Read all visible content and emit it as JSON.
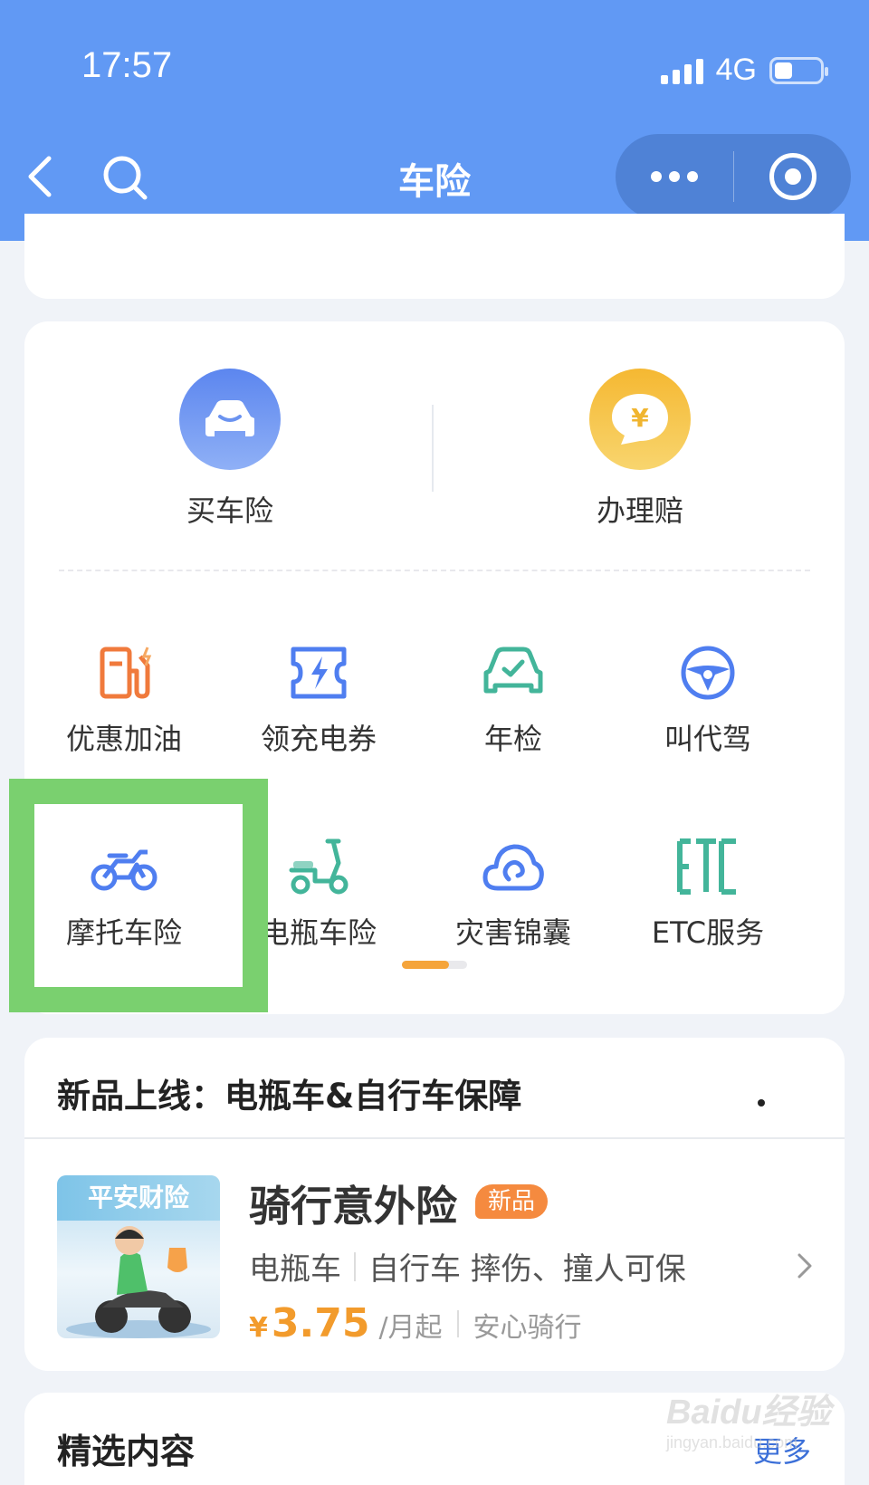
{
  "status_bar": {
    "time": "17:57",
    "network": "4G"
  },
  "nav": {
    "title": "车险",
    "icons": [
      "back-icon",
      "search-icon",
      "more-icon",
      "close-miniprogram-icon"
    ]
  },
  "services": {
    "primary": [
      {
        "label": "买车险",
        "icon": "car-icon",
        "color": "#6b93f0"
      },
      {
        "label": "办理赔",
        "icon": "yuan-chat-icon",
        "color": "#f6c13a"
      }
    ],
    "grid": [
      {
        "label": "优惠加油",
        "icon": "fuel-pump-icon",
        "color": "#f07a3c"
      },
      {
        "label": "领充电券",
        "icon": "charging-coupon-icon",
        "color": "#4f7ef0"
      },
      {
        "label": "年检",
        "icon": "car-check-icon",
        "color": "#43b59a"
      },
      {
        "label": "叫代驾",
        "icon": "steering-wheel-icon",
        "color": "#4f7ef0"
      },
      {
        "label": "摩托车险",
        "icon": "motorcycle-icon",
        "color": "#4f7ef0"
      },
      {
        "label": "电瓶车险",
        "icon": "scooter-icon",
        "color": "#43b59a"
      },
      {
        "label": "灾害锦囊",
        "icon": "cloud-icon",
        "color": "#4f7ef0"
      },
      {
        "label": "ETC服务",
        "icon": "etc-icon",
        "color": "#43b59a"
      }
    ],
    "pager_progress": 0.72
  },
  "new_product": {
    "heading": "新品上线：电瓶车&自行车保障",
    "brand": "平安财险",
    "name": "骑行意外险",
    "badge": "新品",
    "tag1": "电瓶车",
    "tag2": "自行车 摔伤、撞人可保",
    "currency": "¥",
    "price": "3.75",
    "unit": "/月起",
    "price_tag": "安心骑行"
  },
  "featured": {
    "title": "精选内容",
    "more": "更多"
  },
  "watermark": {
    "main": "Baidu经验",
    "sub": "jingyan.baidu.com"
  },
  "colors": {
    "header": "#6199f4",
    "highlight": "#7ad06f",
    "price": "#f29b2c"
  }
}
